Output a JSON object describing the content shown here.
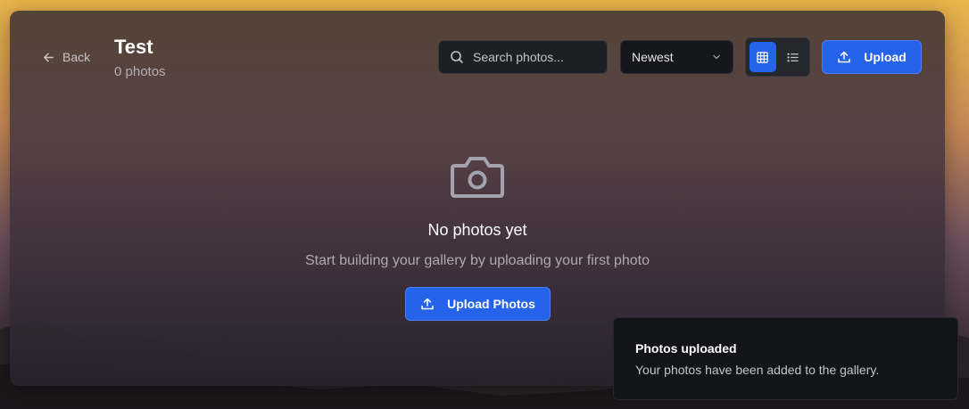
{
  "header": {
    "back_label": "Back",
    "title": "Test",
    "photo_count": "0 photos"
  },
  "toolbar": {
    "search_placeholder": "Search photos...",
    "sort_value": "Newest",
    "view_mode": "grid",
    "upload_label": "Upload"
  },
  "empty_state": {
    "icon": "camera-icon",
    "title": "No photos yet",
    "subtitle": "Start building your gallery by uploading your first photo",
    "button_label": "Upload Photos"
  },
  "toast": {
    "title": "Photos uploaded",
    "message": "Your photos have been added to the gallery."
  },
  "colors": {
    "accent": "#2563eb",
    "panel": "#4a3a44",
    "toast_bg": "#131418"
  }
}
